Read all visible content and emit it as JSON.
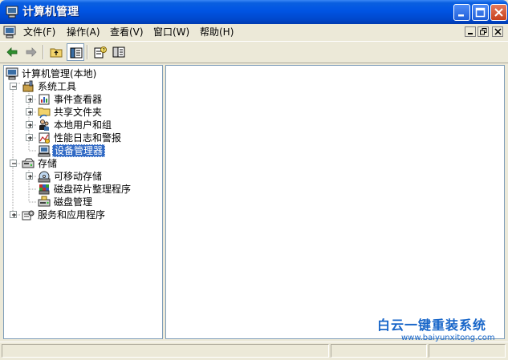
{
  "window": {
    "title": "计算机管理",
    "controls": [
      "minimize-icon",
      "maximize-icon",
      "close-icon"
    ]
  },
  "menubar": {
    "items": [
      {
        "label": "文件(F)"
      },
      {
        "label": "操作(A)"
      },
      {
        "label": "查看(V)"
      },
      {
        "label": "窗口(W)"
      },
      {
        "label": "帮助(H)"
      }
    ]
  },
  "toolbar": {
    "buttons": [
      "back-arrow-icon",
      "forward-arrow-icon",
      "up-folder-icon",
      "show-hide-tree-icon",
      "properties-help-icon",
      "view-pane-icon"
    ]
  },
  "tree": {
    "root": "计算机管理(本地)",
    "items": [
      {
        "label": "系统工具",
        "icon": "toolbox-icon"
      },
      {
        "label": "事件查看器",
        "icon": "event-viewer-icon"
      },
      {
        "label": "共享文件夹",
        "icon": "shared-folder-icon"
      },
      {
        "label": "本地用户和组",
        "icon": "users-icon"
      },
      {
        "label": "性能日志和警报",
        "icon": "performance-icon"
      },
      {
        "label": "设备管理器",
        "icon": "device-manager-icon"
      },
      {
        "label": "存储",
        "icon": "storage-icon"
      },
      {
        "label": "可移动存储",
        "icon": "removable-storage-icon"
      },
      {
        "label": "磁盘碎片整理程序",
        "icon": "defrag-icon"
      },
      {
        "label": "磁盘管理",
        "icon": "disk-management-icon"
      },
      {
        "label": "服务和应用程序",
        "icon": "services-icon"
      }
    ],
    "selected": "设备管理器"
  },
  "watermark": {
    "title": "白云一键重装系统",
    "url": "www.baiyunxitong.com"
  },
  "colors": {
    "title_bar": "#0054e3",
    "selection": "#316ac5",
    "watermark": "#1866c9"
  }
}
